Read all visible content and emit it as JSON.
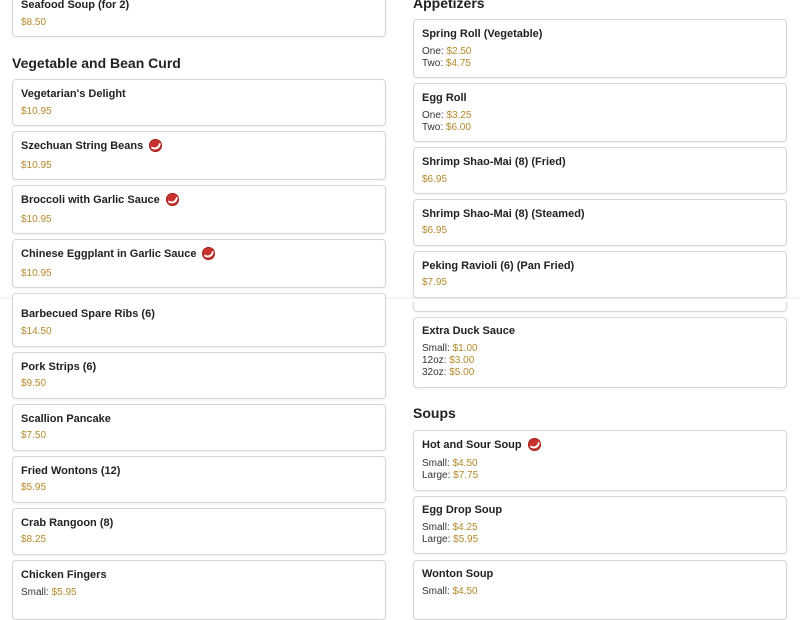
{
  "left": {
    "top_item": {
      "name": "Seafood Soup (for 2)",
      "price": "$8.50"
    },
    "veg_heading": "Vegetable and Bean Curd",
    "veg_items": [
      {
        "name": "Vegetarian's Delight",
        "price": "$10.95"
      },
      {
        "name": "Szechuan String Beans",
        "price": "$10.95"
      },
      {
        "name": "Broccoli with Garlic Sauce",
        "price": "$10.95"
      },
      {
        "name": "Chinese Eggplant in Garlic Sauce",
        "price": "$10.95"
      }
    ],
    "appetizers_items": [
      {
        "name": "Barbecued Spare Ribs (6)",
        "price": "$14.50"
      },
      {
        "name": "Pork Strips (6)",
        "price": "$9.50"
      },
      {
        "name": "Scallion Pancake",
        "price": "$7.50"
      },
      {
        "name": "Fried Wontons (12)",
        "price": "$5.95"
      },
      {
        "name": "Crab Rangoon (8)",
        "price": "$8.25"
      },
      {
        "name": "Chicken Fingers",
        "small_label": "Small:",
        "small_price": "$5.95"
      }
    ]
  },
  "right": {
    "appetizers_heading": "Appetizers",
    "appetizers": [
      {
        "name": "Spring Roll (Vegetable)",
        "one_label": "One:",
        "one_price": "$2.50",
        "two_label": "Two:",
        "two_price": "$4.75"
      },
      {
        "name": "Egg Roll",
        "one_label": "One:",
        "one_price": "$3.25",
        "two_label": "Two:",
        "two_price": "$6.00"
      },
      {
        "name": "Shrimp Shao-Mai (8) (Fried)",
        "price": "$6.95"
      },
      {
        "name": "Shrimp Shao-Mai (8) (Steamed)",
        "price": "$6.95"
      },
      {
        "name": "Peking Ravioli (6) (Pan Fried)",
        "price": "$7.95"
      }
    ],
    "extra_duck": {
      "name": "Extra Duck Sauce",
      "small_label": "Small:",
      "small_price": "$1.00",
      "mid_label": "12oz:",
      "mid_price": "$3.00",
      "large_label": "32oz:",
      "large_price": "$5.00"
    },
    "soups_heading": "Soups",
    "soups": [
      {
        "name": "Hot and Sour Soup",
        "small_label": "Small:",
        "small_price": "$4.50",
        "large_label": "Large:",
        "large_price": "$7.75"
      },
      {
        "name": "Egg Drop Soup",
        "small_label": "Small:",
        "small_price": "$4.25",
        "large_label": "Large:",
        "large_price": "$5.95"
      },
      {
        "name": "Wonton Soup",
        "small_label": "Small:",
        "small_price": "$4.50"
      }
    ]
  },
  "spicy_icon": "spicy-pepper-icon",
  "colors": {
    "price": "#b5892b",
    "spicy": "#c8332e",
    "card_border": "#d6d6d6"
  }
}
